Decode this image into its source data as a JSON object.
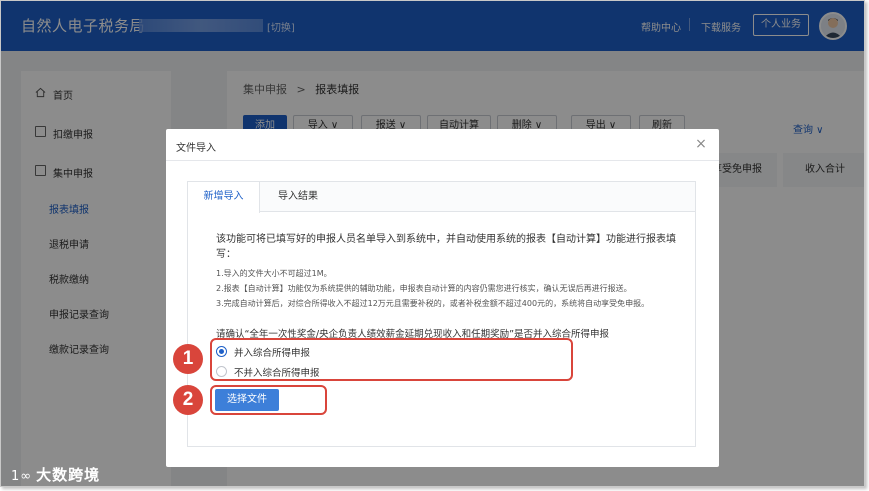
{
  "header": {
    "brand": "自然人电子税务局",
    "switch_label": "[切换]",
    "help_label": "帮助中心",
    "download_label": "下载服务",
    "personal_btn": "个人业务"
  },
  "sidebar": {
    "items": [
      {
        "label": "首页"
      },
      {
        "label": "扣缴申报"
      },
      {
        "label": "集中申报"
      }
    ],
    "sub_items": [
      {
        "label": "报表填报"
      },
      {
        "label": "退税申请"
      },
      {
        "label": "税款缴纳"
      },
      {
        "label": "申报记录查询"
      },
      {
        "label": "缴款记录查询"
      }
    ]
  },
  "main": {
    "breadcrumb_parent": "集中申报",
    "breadcrumb_sep": ">",
    "breadcrumb_current": "报表填报",
    "toolbar": {
      "add": "添加",
      "import": "导入 ∨",
      "report": "报送 ∨",
      "auto_calc": "自动计算",
      "delete": "删除 ∨",
      "export": "导出 ∨",
      "refresh": "刷新"
    },
    "query": "查询 ∨",
    "columns": [
      "享受免申报",
      "收入合计"
    ]
  },
  "modal": {
    "title": "文件导入",
    "tabs": [
      {
        "label": "新增导入"
      },
      {
        "label": "导入结果"
      }
    ],
    "description": "该功能可将已填写好的申报人员名单导入到系统中，并自动使用系统的报表【自动计算】功能进行报表填写：",
    "notes": [
      "1.导入的文件大小不可超过1M。",
      "2.报表【自动计算】功能仅为系统提供的辅助功能，申报表自动计算的内容仍需您进行核实，确认无误后再进行报送。",
      "3.完成自动计算后，对综合所得收入不超过12万元且需要补税的，或者补税金额不超过400元的，系统将自动享受免申报。"
    ],
    "confirm_text": "请确认“全年一次性奖金/央企负责人绩效薪金延期兑现收入和任期奖励”是否并入综合所得申报",
    "options": [
      {
        "label": "并入综合所得申报",
        "selected": true
      },
      {
        "label": "不并入综合所得申报",
        "selected": false
      }
    ],
    "choose_file": "选择文件"
  },
  "callouts": [
    "1",
    "2"
  ],
  "watermark": "大数跨境",
  "colors": {
    "primary": "#1e60c8",
    "highlight": "#d9453b"
  }
}
